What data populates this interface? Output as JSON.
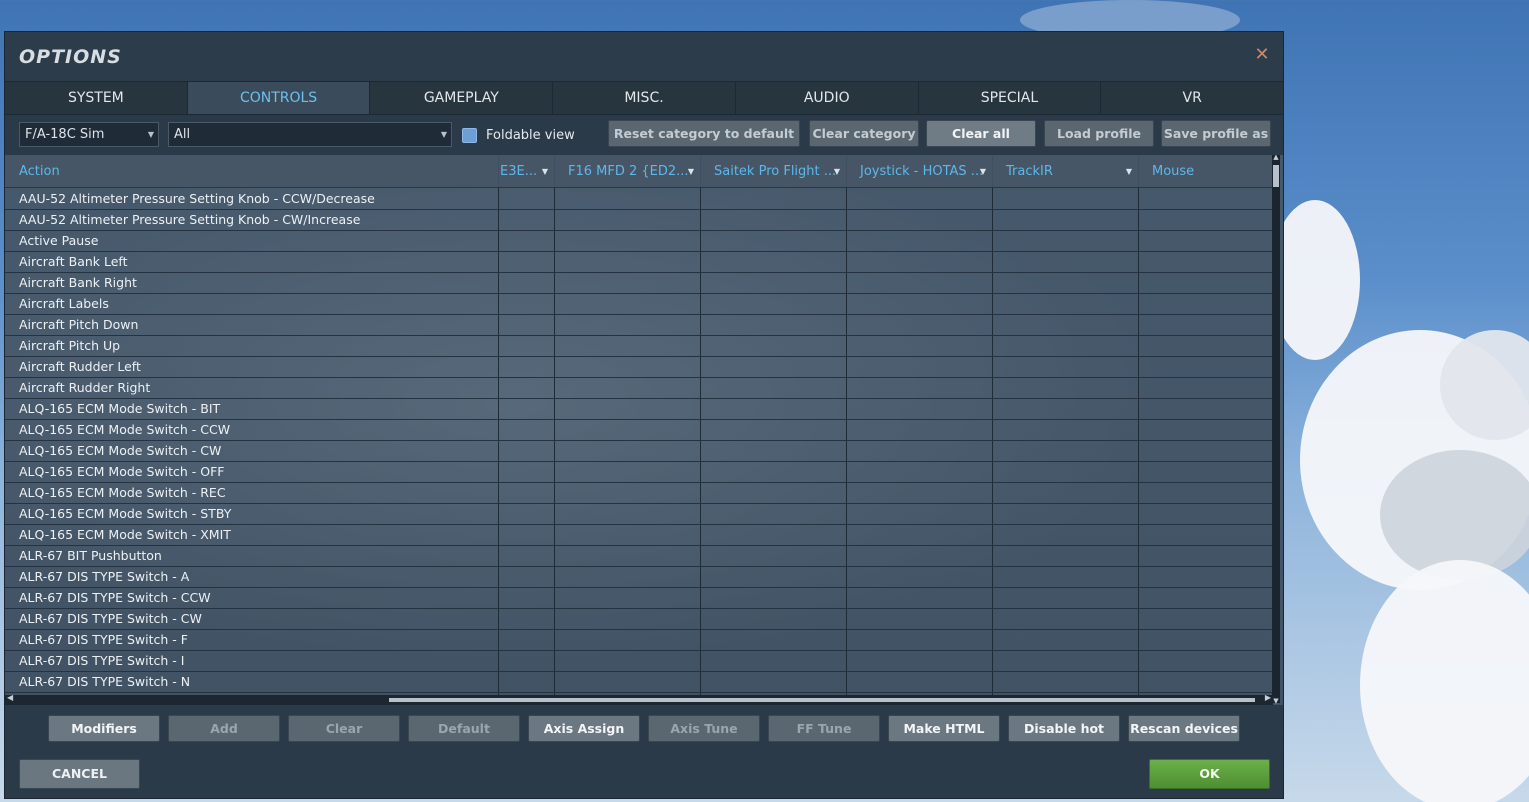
{
  "window": {
    "title": "OPTIONS"
  },
  "tabs": [
    {
      "label": "SYSTEM",
      "active": false
    },
    {
      "label": "CONTROLS",
      "active": true
    },
    {
      "label": "GAMEPLAY",
      "active": false
    },
    {
      "label": "MISC.",
      "active": false
    },
    {
      "label": "AUDIO",
      "active": false
    },
    {
      "label": "SPECIAL",
      "active": false
    },
    {
      "label": "VR",
      "active": false
    }
  ],
  "toolbar": {
    "aircraft_select": "F/A-18C Sim",
    "category_select": "All",
    "foldable_label": "Foldable view",
    "buttons": [
      "Reset category to default",
      "Clear category",
      "Clear all",
      "Load profile",
      "Save profile as"
    ]
  },
  "grid": {
    "columns": [
      "Action",
      "E3E...",
      "F16 MFD 2 {ED2...",
      "Saitek Pro Flight ...",
      "Joystick - HOTAS ...",
      "TrackIR",
      "Mouse"
    ],
    "rows": [
      "AAU-52 Altimeter Pressure Setting Knob - CCW/Decrease",
      "AAU-52 Altimeter Pressure Setting Knob - CW/Increase",
      "Active Pause",
      "Aircraft Bank Left",
      "Aircraft Bank Right",
      "Aircraft Labels",
      "Aircraft Pitch Down",
      "Aircraft Pitch Up",
      "Aircraft Rudder Left",
      "Aircraft Rudder Right",
      "ALQ-165 ECM Mode Switch - BIT",
      "ALQ-165 ECM Mode Switch - CCW",
      "ALQ-165 ECM Mode Switch - CW",
      "ALQ-165 ECM Mode Switch - OFF",
      "ALQ-165 ECM Mode Switch - REC",
      "ALQ-165 ECM Mode Switch - STBY",
      "ALQ-165 ECM Mode Switch - XMIT",
      "ALR-67 BIT Pushbutton",
      "ALR-67 DIS TYPE Switch - A",
      "ALR-67 DIS TYPE Switch - CCW",
      "ALR-67 DIS TYPE Switch - CW",
      "ALR-67 DIS TYPE Switch - F",
      "ALR-67 DIS TYPE Switch - I",
      "ALR-67 DIS TYPE Switch - N"
    ]
  },
  "bottom_buttons": [
    {
      "label": "Modifiers",
      "enabled": true
    },
    {
      "label": "Add",
      "enabled": false
    },
    {
      "label": "Clear",
      "enabled": false
    },
    {
      "label": "Default",
      "enabled": false
    },
    {
      "label": "Axis Assign",
      "enabled": true
    },
    {
      "label": "Axis Tune",
      "enabled": false
    },
    {
      "label": "FF Tune",
      "enabled": false
    },
    {
      "label": "Make HTML",
      "enabled": true
    },
    {
      "label": "Disable hot plug",
      "enabled": true
    },
    {
      "label": "Rescan devices",
      "enabled": true
    }
  ],
  "footer": {
    "cancel_label": "CANCEL",
    "ok_label": "OK"
  },
  "colors": {
    "accent": "#5cb8e8",
    "ok_green": "#5fa03f",
    "panel": "#2b3a49"
  }
}
